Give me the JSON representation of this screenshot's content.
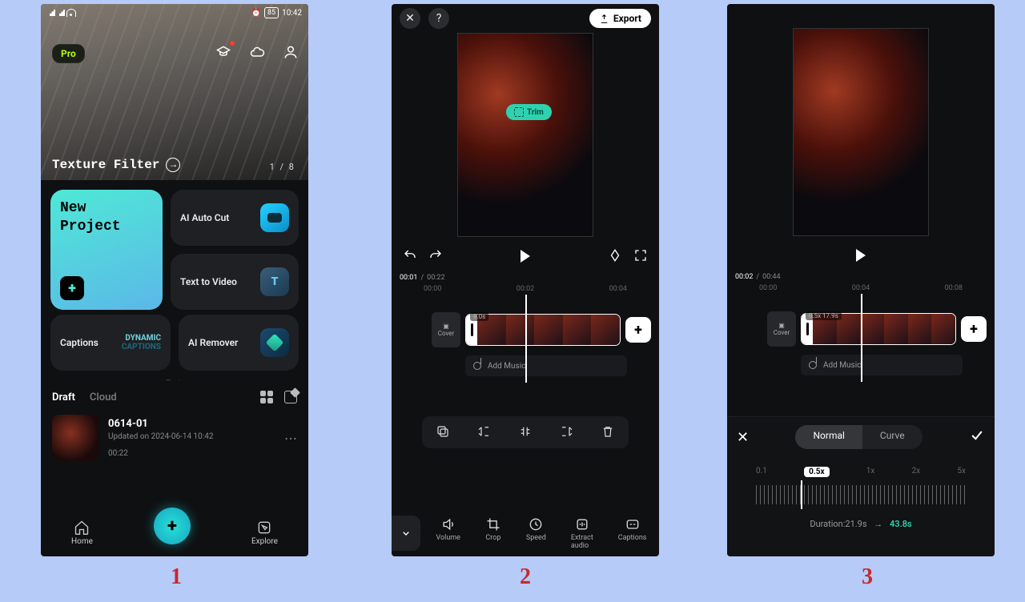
{
  "steps": {
    "s1": "1",
    "s2": "2",
    "s3": "3"
  },
  "status": {
    "time": "10:42",
    "battery": "85"
  },
  "p1": {
    "pro": "Pro",
    "hero_label": "Texture Filter",
    "hero_count": "1 / 8",
    "new_project": "New\nProject",
    "ai_auto_cut": "AI Auto Cut",
    "text_to_video": "Text to Video",
    "captions": "Captions",
    "dyn1": "DYNAMIC",
    "dyn2": "CAPTIONS",
    "ai_remover": "AI Remover",
    "tab_draft": "Draft",
    "tab_cloud": "Cloud",
    "draft_title": "0614-01",
    "draft_sub": "Updated on 2024-06-14 10:42",
    "draft_dur": "00:22",
    "nav_home": "Home",
    "nav_explore": "Explore"
  },
  "p2": {
    "export": "Export",
    "trim": "Trim",
    "time_cur": "00:01",
    "time_total": "00:22",
    "ruler": [
      "00:00",
      "00:02",
      "00:04"
    ],
    "cover": "Cover",
    "clip_badge": "9.0s",
    "add_music": "Add Music",
    "bottom": {
      "volume": "Volume",
      "crop": "Crop",
      "speed": "Speed",
      "extract": "Extract\naudio",
      "captions": "Captions"
    }
  },
  "p3": {
    "time_cur": "00:02",
    "time_total": "00:44",
    "ruler": [
      "00:00",
      "00:04",
      "00:08"
    ],
    "cover": "Cover",
    "clip_badge": "0.5x 17.9s",
    "add_music": "Add Music",
    "seg_normal": "Normal",
    "seg_curve": "Curve",
    "speeds": [
      "0.1",
      "0.5x",
      "1x",
      "2x",
      "5x"
    ],
    "duration_label": "Duration:",
    "duration_from": "21.9s",
    "duration_to": "43.8s"
  }
}
